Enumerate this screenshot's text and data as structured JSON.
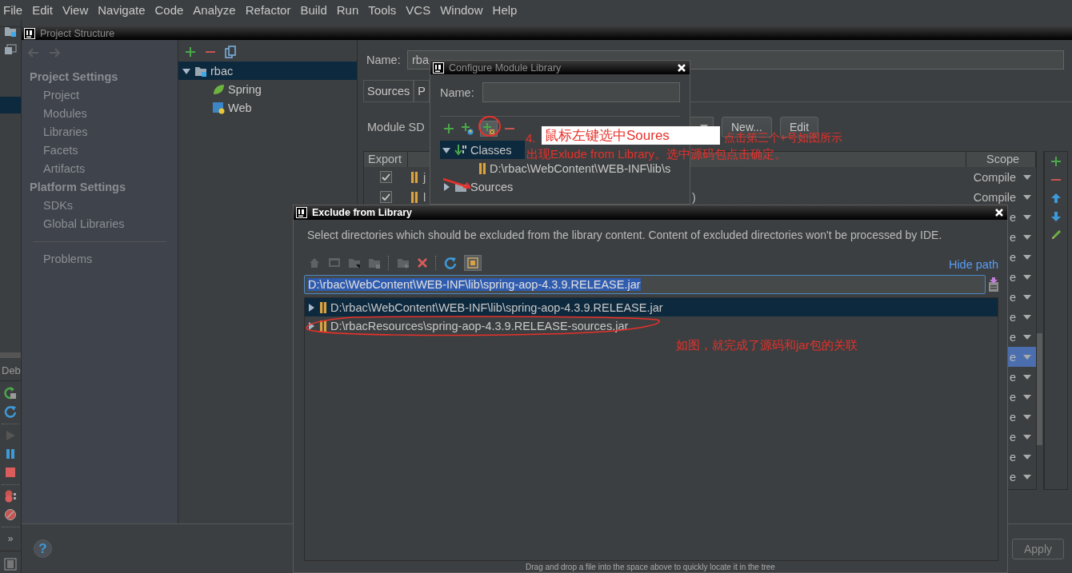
{
  "menu_bar": [
    "File",
    "Edit",
    "View",
    "Navigate",
    "Code",
    "Analyze",
    "Refactor",
    "Build",
    "Run",
    "Tools",
    "VCS",
    "Window",
    "Help"
  ],
  "tool_strip": {
    "debug_label": "Deb",
    "more": "»"
  },
  "project_structure": {
    "title": "Project Structure",
    "nav": [
      {
        "heading": "Project Settings",
        "items": [
          {
            "label": "Project",
            "selected": false
          },
          {
            "label": "Modules",
            "selected": false
          },
          {
            "label": "Libraries",
            "selected": false
          },
          {
            "label": "Facets",
            "selected": false
          },
          {
            "label": "Artifacts",
            "selected": false
          }
        ]
      },
      {
        "heading": "Platform Settings",
        "items": [
          {
            "label": "SDKs",
            "selected": false
          },
          {
            "label": "Global Libraries",
            "selected": false
          }
        ]
      },
      {
        "items": [
          {
            "label": "Problems",
            "selected": false
          }
        ]
      }
    ],
    "module_tree": [
      {
        "label": "rbac",
        "kind": "module",
        "expanded": true,
        "selected": true,
        "children": [
          {
            "label": "Spring",
            "kind": "spring",
            "selected": false
          },
          {
            "label": "Web",
            "kind": "web",
            "selected": false
          }
        ]
      }
    ],
    "name_label": "Name:",
    "name_value": "rba",
    "tabs": [
      {
        "label": "Sources",
        "selected": false
      },
      {
        "label": "P",
        "selected": false
      }
    ],
    "sdk_label": "Module SD",
    "sdk_buttons": [
      "New...",
      "Edit"
    ],
    "dependencies": {
      "columns": [
        "Export",
        "Scope"
      ],
      "rows": [
        {
          "checked": true,
          "column_2": "j",
          "scope": "Compile",
          "selected": false
        },
        {
          "checked": true,
          "column_2": "l",
          "column_3": ")",
          "scope": "Compile",
          "selected": false
        },
        {
          "scope": "e",
          "selected": false
        },
        {
          "scope": "e",
          "selected": false
        },
        {
          "scope": "e",
          "selected": false
        },
        {
          "scope": "e",
          "selected": false
        },
        {
          "scope": "e",
          "selected": false
        },
        {
          "scope": "e",
          "selected": false
        },
        {
          "scope": "e",
          "selected": false
        },
        {
          "scope": "e",
          "selected": true
        },
        {
          "scope": "e",
          "selected": false
        },
        {
          "scope": "e",
          "selected": false
        },
        {
          "scope": "e",
          "selected": false
        },
        {
          "scope": "e",
          "selected": false
        },
        {
          "scope": "e",
          "selected": false
        },
        {
          "scope": "e",
          "selected": false
        }
      ]
    },
    "help_button": "?",
    "apply_button": "Apply"
  },
  "configure_dialog": {
    "title": "Configure Module Library",
    "name_label": "Name:",
    "tree": [
      {
        "label": "Classes",
        "kind": "classes",
        "expanded": true,
        "selected": true,
        "children": [
          {
            "label": "D:\\rbac\\WebContent\\WEB-INF\\lib\\s",
            "kind": "jar",
            "selected": false
          }
        ]
      },
      {
        "label": "Sources",
        "kind": "sources",
        "expanded": false,
        "selected": false
      }
    ]
  },
  "exclude_dialog": {
    "title": "Exclude from Library",
    "description": "Select directories which should be excluded from the library content. Content of excluded directories won't be processed by IDE.",
    "hide_path": "Hide path",
    "path_value": "D:\\rbac\\WebContent\\WEB-INF\\lib\\spring-aop-4.3.9.RELEASE.jar",
    "tree": [
      {
        "label": "D:\\rbac\\WebContent\\WEB-INF\\lib\\spring-aop-4.3.9.RELEASE.jar",
        "kind": "jar",
        "expanded": false,
        "selected": true
      },
      {
        "label": "D:\\rbacResources\\spring-aop-4.3.9.RELEASE-sources.jar",
        "kind": "jar",
        "expanded": false,
        "selected": false
      }
    ],
    "hint": "Drag and drop a file into the space above to quickly locate it in the tree"
  },
  "annotations": {
    "step": "4.",
    "boxed": "鼠标左键选中Soures",
    "line_1": "点击第三个+号如图所示",
    "line_2": "出现Exlude from Library。选中源码包点击确定。",
    "result_note": "如图，就完成了源码和jar包的关联"
  }
}
